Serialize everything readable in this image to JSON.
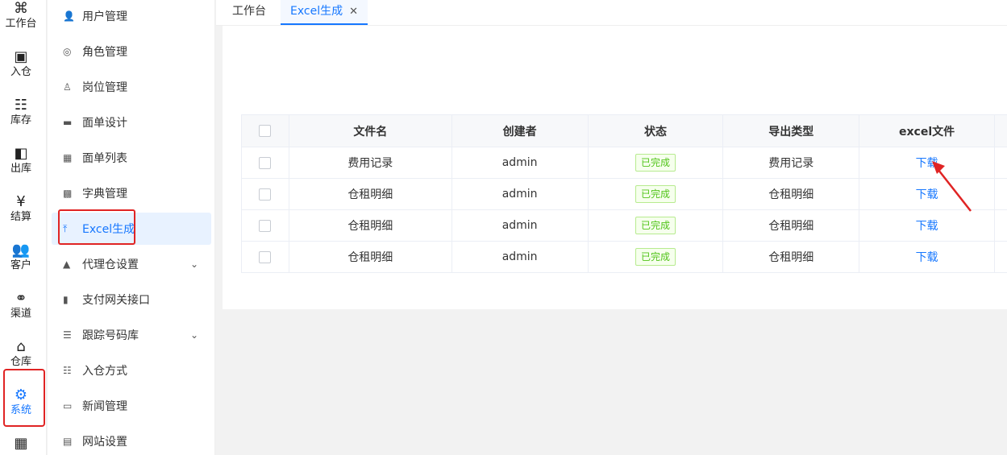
{
  "rail": {
    "items": [
      {
        "icon": "⌘",
        "label": "工作台"
      },
      {
        "icon": "▣",
        "label": "入仓"
      },
      {
        "icon": "☷",
        "label": "库存"
      },
      {
        "icon": "◧",
        "label": "出库"
      },
      {
        "icon": "¥",
        "label": "结算"
      },
      {
        "icon": "👥",
        "label": "客户"
      },
      {
        "icon": "⚭",
        "label": "渠道"
      },
      {
        "icon": "⌂",
        "label": "仓库"
      },
      {
        "icon": "⚙",
        "label": "系统"
      },
      {
        "icon": "▦",
        "label": ""
      }
    ]
  },
  "submenu": {
    "items": [
      {
        "icon": "👤",
        "label": "用户管理"
      },
      {
        "icon": "◎",
        "label": "角色管理"
      },
      {
        "icon": "♙",
        "label": "岗位管理"
      },
      {
        "icon": "▬",
        "label": "面单设计"
      },
      {
        "icon": "▦",
        "label": "面单列表"
      },
      {
        "icon": "▩",
        "label": "字典管理"
      },
      {
        "icon": "⤒",
        "label": "Excel生成"
      },
      {
        "icon": "▲",
        "label": "代理仓设置"
      },
      {
        "icon": "▮",
        "label": "支付网关接口"
      },
      {
        "icon": "☰",
        "label": "跟踪号码库"
      },
      {
        "icon": "☷",
        "label": "入仓方式"
      },
      {
        "icon": "▭",
        "label": "新闻管理"
      },
      {
        "icon": "▤",
        "label": "网站设置"
      }
    ],
    "chevron": "⌄"
  },
  "tabs": [
    {
      "label": "工作台"
    },
    {
      "label": "Excel生成",
      "close": "✕"
    }
  ],
  "table": {
    "headers": [
      "文件名",
      "创建者",
      "状态",
      "导出类型",
      "excel文件"
    ],
    "rows": [
      {
        "file": "费用记录",
        "creator": "admin",
        "status": "已完成",
        "type": "费用记录",
        "action": "下载"
      },
      {
        "file": "仓租明细",
        "creator": "admin",
        "status": "已完成",
        "type": "仓租明细",
        "action": "下载"
      },
      {
        "file": "仓租明细",
        "creator": "admin",
        "status": "已完成",
        "type": "仓租明细",
        "action": "下载"
      },
      {
        "file": "仓租明细",
        "creator": "admin",
        "status": "已完成",
        "type": "仓租明细",
        "action": "下载"
      }
    ]
  },
  "colors": {
    "accent": "#1677ff",
    "highlight": "#e02424",
    "success": "#52c41a"
  }
}
